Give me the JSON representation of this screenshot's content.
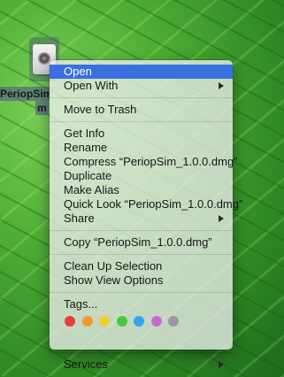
{
  "desktop_icon": {
    "label_line1": "PeriopSim",
    "label_line2": "m"
  },
  "menu": {
    "open": "Open",
    "open_with": "Open With",
    "move_to_trash": "Move to Trash",
    "get_info": "Get Info",
    "rename": "Rename",
    "compress": "Compress “PeriopSim_1.0.0.dmg”",
    "duplicate": "Duplicate",
    "make_alias": "Make Alias",
    "quick_look": "Quick Look “PeriopSim_1.0.0.dmg”",
    "share": "Share",
    "copy": "Copy “PeriopSim_1.0.0.dmg”",
    "clean_up_selection": "Clean Up Selection",
    "show_view_options": "Show View Options",
    "tags": "Tags...",
    "services": "Services"
  },
  "tag_colors": [
    {
      "name": "red",
      "color": "#ee3b3b"
    },
    {
      "name": "orange",
      "color": "#f39a2c"
    },
    {
      "name": "yellow",
      "color": "#f2cd2e"
    },
    {
      "name": "green",
      "color": "#46c93f"
    },
    {
      "name": "blue",
      "color": "#2fa4f2"
    },
    {
      "name": "purple",
      "color": "#c66bd6"
    },
    {
      "name": "gray",
      "color": "#9a9a9e"
    }
  ],
  "colors": {
    "highlight": "#3a6fe0"
  }
}
